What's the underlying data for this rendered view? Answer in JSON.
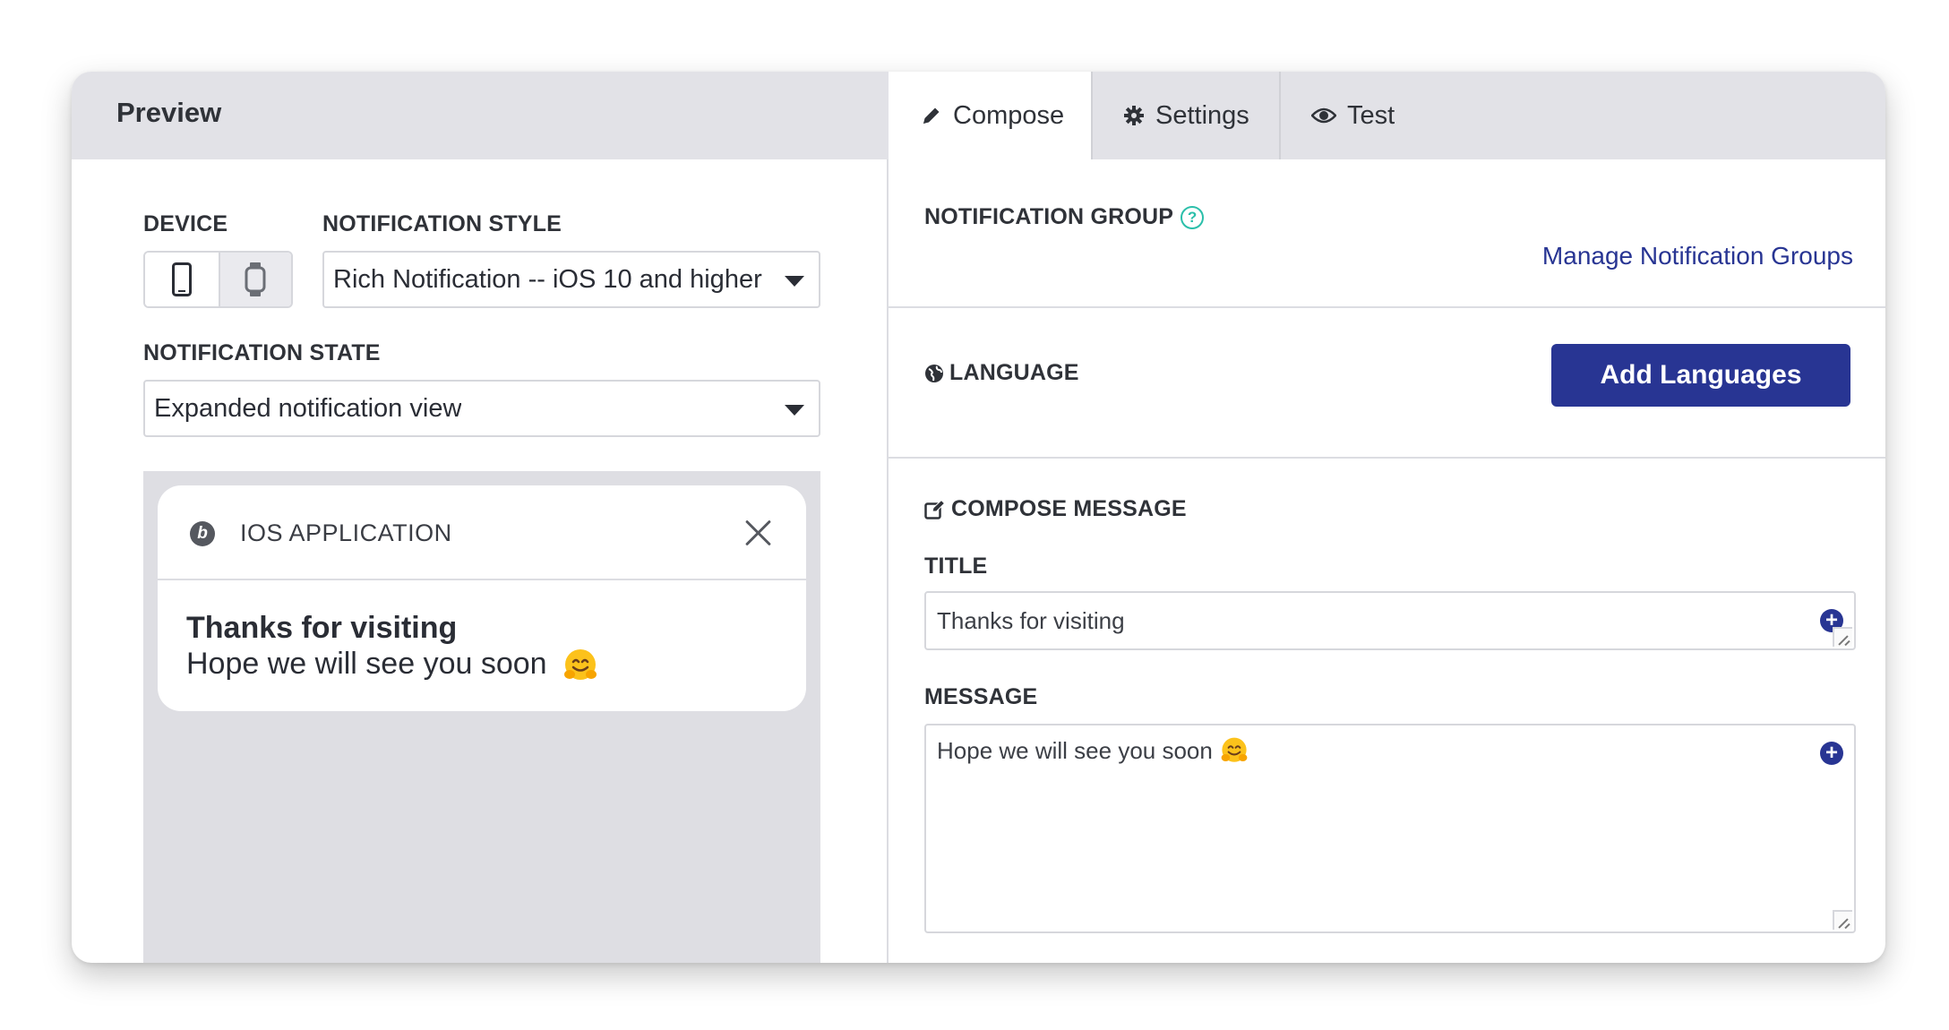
{
  "preview": {
    "title": "Preview",
    "device_label": "DEVICE",
    "devices": [
      {
        "icon": "smartphone-icon",
        "active": true
      },
      {
        "icon": "smartwatch-icon",
        "active": false
      }
    ],
    "style_label": "NOTIFICATION STYLE",
    "style_value": "Rich Notification -- iOS 10 and higher",
    "state_label": "NOTIFICATION STATE",
    "state_value": "Expanded notification view",
    "notification": {
      "app_name": "IOS APPLICATION",
      "app_icon_glyph": "b",
      "title": "Thanks for visiting",
      "body": "Hope we will see you soon"
    }
  },
  "tabs": [
    {
      "label": "Compose",
      "icon": "pencil-icon",
      "active": true
    },
    {
      "label": "Settings",
      "icon": "gear-icon",
      "active": false
    },
    {
      "label": "Test",
      "icon": "eye-icon",
      "active": false
    }
  ],
  "compose": {
    "group_label": "NOTIFICATION GROUP",
    "help_glyph": "?",
    "manage_link": "Manage Notification Groups",
    "language_label": "LANGUAGE",
    "add_languages": "Add Languages",
    "compose_label": "COMPOSE MESSAGE",
    "title_label": "TITLE",
    "title_value": "Thanks for visiting",
    "message_label": "MESSAGE",
    "message_value": "Hope we will see you soon",
    "plus_glyph": "+"
  },
  "colors": {
    "accent": "#283593",
    "header_bg": "#e2e2e7",
    "help_teal": "#2bbfaa",
    "preview_bg": "#dedee3"
  }
}
